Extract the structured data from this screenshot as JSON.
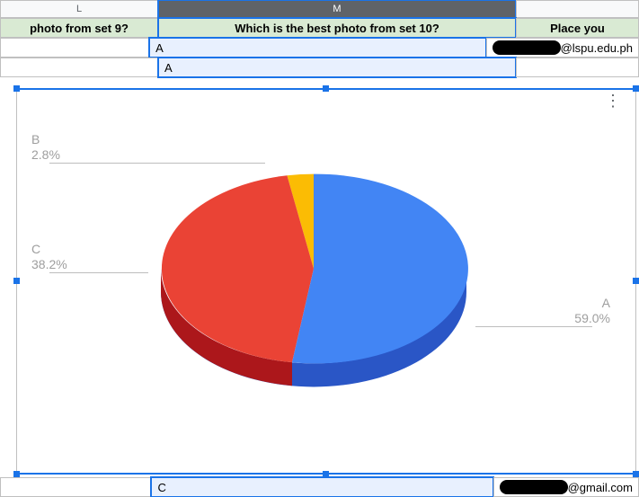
{
  "columns": {
    "L": "L",
    "M": "M",
    "N": ""
  },
  "headers": {
    "L": "photo from set 9?",
    "M": "Which is the best photo from set 10?",
    "N": "Place you"
  },
  "rows": [
    {
      "L": "",
      "M": "A",
      "N_suffix": "@lspu.edu.ph"
    },
    {
      "L": "",
      "M": "A",
      "N_suffix": ""
    }
  ],
  "bottom": {
    "M": "C",
    "N_suffix": "@gmail.com"
  },
  "chart_menu_icon": "⋮",
  "chart_data": {
    "type": "pie",
    "title": "",
    "series": [
      {
        "name": "A",
        "value": 59.0,
        "color": "#4285f4"
      },
      {
        "name": "C",
        "value": 38.2,
        "color": "#ea4335"
      },
      {
        "name": "B",
        "value": 2.8,
        "color": "#fbbc04"
      }
    ]
  },
  "labels": {
    "A": {
      "name": "A",
      "pct": "59.0%"
    },
    "B": {
      "name": "B",
      "pct": "2.8%"
    },
    "C": {
      "name": "C",
      "pct": "38.2%"
    }
  }
}
